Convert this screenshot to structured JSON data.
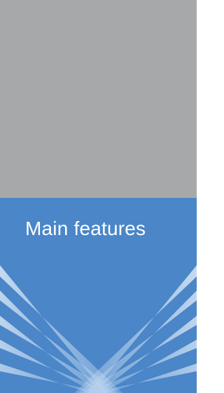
{
  "section": {
    "title": "Main features"
  },
  "colors": {
    "top_band": "#a7a8aa",
    "blue_band": "#4a86c8",
    "ray_light": "#d6e6f6",
    "title_text": "#ffffff"
  }
}
